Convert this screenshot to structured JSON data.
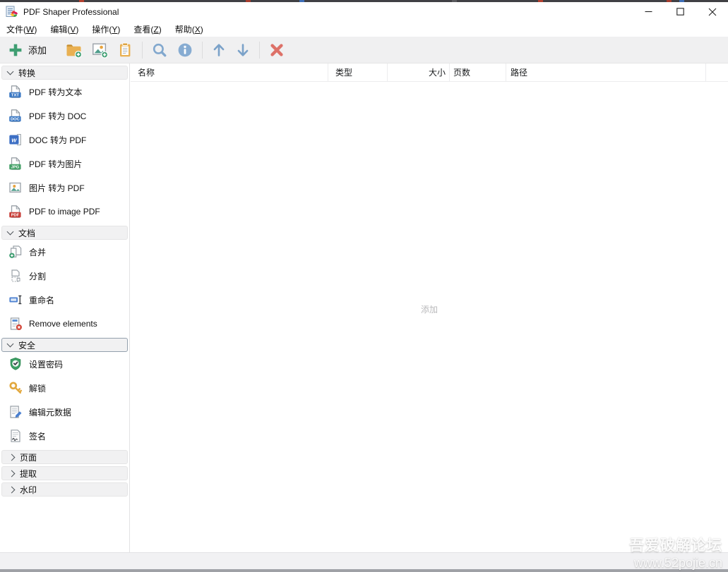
{
  "window": {
    "title": "PDF Shaper Professional"
  },
  "menubar": {
    "items": [
      "文件(W)",
      "编辑(V)",
      "操作(Y)",
      "查看(Z)",
      "帮助(X)"
    ]
  },
  "toolbar": {
    "add_label": "添加"
  },
  "sidebar": {
    "sections": [
      {
        "id": "convert",
        "label": "转换",
        "expanded": true,
        "selected": false,
        "items": [
          {
            "id": "pdf-to-text",
            "label": "PDF 转为文本",
            "icon": "badge",
            "badge": "TXT",
            "badge_color": "#3c79c4"
          },
          {
            "id": "pdf-to-doc",
            "label": "PDF 转为 DOC",
            "icon": "badge",
            "badge": "DOC",
            "badge_color": "#3c79c4"
          },
          {
            "id": "doc-to-pdf",
            "label": "DOC 转为 PDF",
            "icon": "word",
            "badge": "w"
          },
          {
            "id": "pdf-to-image",
            "label": "PDF 转为图片",
            "icon": "badge",
            "badge": "JPG",
            "badge_color": "#46a169"
          },
          {
            "id": "image-to-pdf",
            "label": "图片 转为 PDF",
            "icon": "image"
          },
          {
            "id": "pdf-to-image-pdf",
            "label": "PDF to image PDF",
            "icon": "badge",
            "badge": "PDF",
            "badge_color": "#c8403a"
          }
        ]
      },
      {
        "id": "document",
        "label": "文档",
        "expanded": true,
        "selected": false,
        "items": [
          {
            "id": "merge",
            "label": "合并",
            "icon": "merge"
          },
          {
            "id": "split",
            "label": "分割",
            "icon": "split"
          },
          {
            "id": "rename",
            "label": "重命名",
            "icon": "rename"
          },
          {
            "id": "remove-elements",
            "label": "Remove elements",
            "icon": "remove"
          }
        ]
      },
      {
        "id": "security",
        "label": "安全",
        "expanded": true,
        "selected": true,
        "items": [
          {
            "id": "set-password",
            "label": "设置密码",
            "icon": "shield"
          },
          {
            "id": "unlock",
            "label": "解锁",
            "icon": "key"
          },
          {
            "id": "edit-metadata",
            "label": "编辑元数据",
            "icon": "metadata"
          },
          {
            "id": "sign",
            "label": "签名",
            "icon": "signature"
          }
        ]
      },
      {
        "id": "pages",
        "label": "页面",
        "expanded": false,
        "selected": false,
        "items": []
      },
      {
        "id": "extract",
        "label": "提取",
        "expanded": false,
        "selected": false,
        "items": []
      },
      {
        "id": "watermark",
        "label": "水印",
        "expanded": false,
        "selected": false,
        "items": []
      }
    ]
  },
  "table": {
    "columns": [
      {
        "id": "name",
        "label": "名称"
      },
      {
        "id": "type",
        "label": "类型"
      },
      {
        "id": "size",
        "label": "大小"
      },
      {
        "id": "pages",
        "label": "页数"
      },
      {
        "id": "path",
        "label": "路径"
      }
    ],
    "rows": []
  },
  "main": {
    "empty_hint": "添加"
  },
  "watermark": {
    "line1": "吾爱破解论坛",
    "line2": "www.52pojie.cn"
  },
  "colors": {
    "accent_green": "#3f9e72",
    "steel_blue": "#7ba3cc",
    "delete_red": "#dd7168",
    "amber": "#e9b052",
    "word_blue": "#3d6fc4",
    "toolbar_bg": "#f0f0f1",
    "status_bg": "#f1f1f3"
  }
}
